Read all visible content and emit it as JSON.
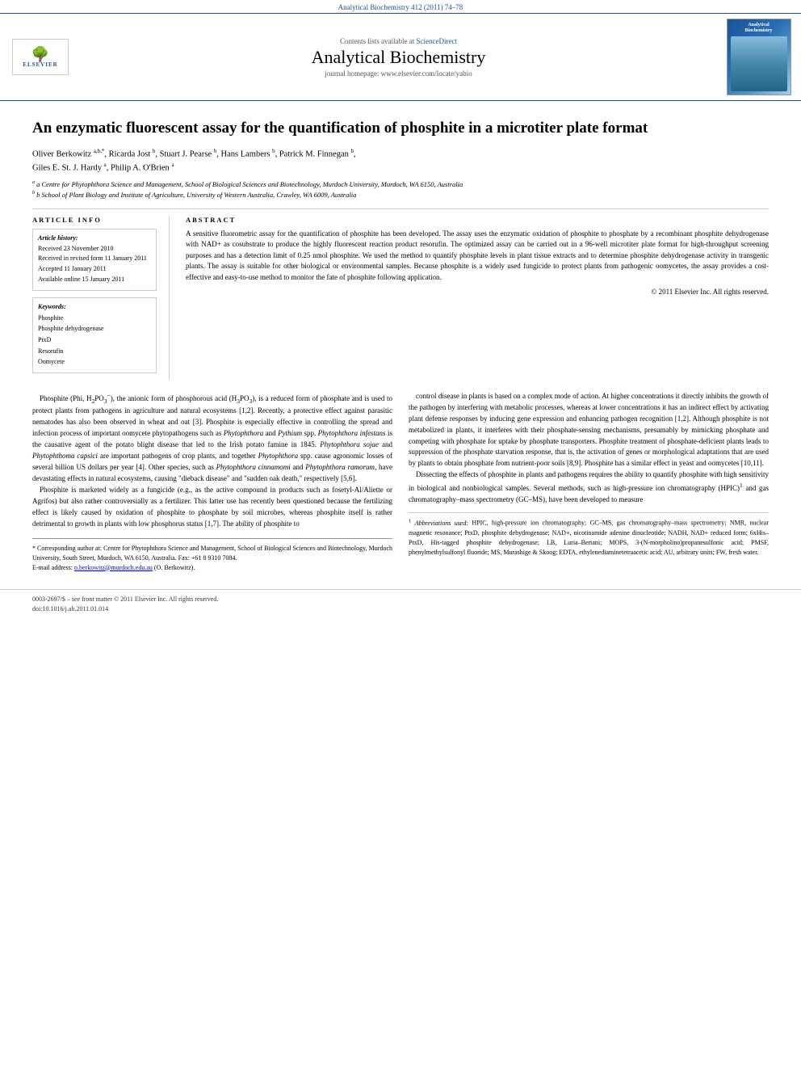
{
  "topbar": {
    "journal_ref": "Analytical Biochemistry 412 (2011) 74–78"
  },
  "header": {
    "sciencedirect_text": "Contents lists available at",
    "sciencedirect_link": "ScienceDirect",
    "journal_title": "Analytical Biochemistry",
    "homepage_text": "journal homepage: www.elsevier.com/locate/yabio",
    "elsevier_label": "ELSEVIER",
    "cover_title": "Analytical Biochemistry"
  },
  "article": {
    "title": "An enzymatic fluorescent assay for the quantification of phosphite in a microtiter plate format",
    "authors": "Oliver Berkowitz a,b,*, Ricarda Jost b, Stuart J. Pearse b, Hans Lambers b, Patrick M. Finnegan b, Giles E. St. J. Hardy a, Philip A. O'Brien a",
    "affiliation_a": "a Centre for Phytophthora Science and Management, School of Biological Sciences and Biotechnology, Murdoch University, Murdoch, WA 6150, Australia",
    "affiliation_b": "b School of Plant Biology and Institute of Agriculture, University of Western Australia, Crawley, WA 6009, Australia"
  },
  "article_info": {
    "section_label": "ARTICLE INFO",
    "history_label": "Article history:",
    "received": "Received 23 November 2010",
    "revised": "Received in revised form 11 January 2011",
    "accepted": "Accepted 11 January 2011",
    "available": "Available online 15 January 2011",
    "keywords_label": "Keywords:",
    "keywords": [
      "Phosphite",
      "Phosphite dehydrogenase",
      "PtxD",
      "Resorufin",
      "Oomycete"
    ]
  },
  "abstract": {
    "section_label": "ABSTRACT",
    "text": "A sensitive fluorometric assay for the quantification of phosphite has been developed. The assay uses the enzymatic oxidation of phosphite to phosphate by a recombinant phosphite dehydrogenase with NAD+ as cosubstrate to produce the highly fluorescent reaction product resorufin. The optimized assay can be carried out in a 96-well microtiter plate format for high-throughput screening purposes and has a detection limit of 0.25 nmol phosphite. We used the method to quantify phosphite levels in plant tissue extracts and to determine phosphite dehydrogenase activity in transgenic plants. The assay is suitable for other biological or environmental samples. Because phosphite is a widely used fungicide to protect plants from pathogenic oomycetes, the assay provides a cost-effective and easy-to-use method to monitor the fate of phosphite following application.",
    "copyright": "© 2011 Elsevier Inc. All rights reserved."
  },
  "body": {
    "left_col": "Phosphite (Phi, H2PO3−), the anionic form of phosphorous acid (H3PO3), is a reduced form of phosphate and is used to protect plants from pathogens in agriculture and natural ecosystems [1,2]. Recently, a protective effect against parasitic nematodes has also been observed in wheat and oat [3]. Phosphite is especially effective in controlling the spread and infection process of important oomycete phytopathogens such as Phytophthora and Pythium spp. Phytophthora infestans is the causative agent of the potato blight disease that led to the Irish potato famine in 1845. Phytophthora sojae and Phytophthoma capsici are important pathogens of crop plants, and together Phytophthora spp. cause agronomic losses of several billion US dollars per year [4]. Other species, such as Phytophthora cinnamomi and Phytophthora ramorum, have devastating effects in natural ecosystems, causing \"dieback disease\" and \"sudden oak death,\" respectively [5,6]. Phosphite is marketed widely as a fungicide (e.g., as the active compound in products such as fosetyl-Al/Aliette or Agrifos) but also rather controversially as a fertilizer. This latter use has recently been questioned because the fertilizing effect is likely caused by oxidation of phosphite to phosphate by soil microbes, whereas phosphite itself is rather detrimental to growth in plants with low phosphorus status [1,7]. The ability of phosphite to",
    "right_col": "control disease in plants is based on a complex mode of action. At higher concentrations it directly inhibits the growth of the pathogen by interfering with metabolic processes, whereas at lower concentrations it has an indirect effect by activating plant defense responses by inducing gene expression and enhancing pathogen recognition [1,2]. Although phosphite is not metabolized in plants, it interferes with their phosphate-sensing mechanisms, presumably by mimicking phosphate and competing with phosphate for uptake by phosphate transporters. Phosphite treatment of phosphate-deficient plants leads to suppression of the phosphate starvation response, that is, the activation of genes or morphological adaptations that are used by plants to obtain phosphate from nutrient-poor soils [8,9]. Phosphite has a similar effect in yeast and oomycetes [10,11]. Dissecting the effects of phosphite in plants and pathogens requires the ability to quantify phosphite with high sensitivity in biological and nonbiological samples. Several methods, such as high-pressure ion chromatography (HPIC)1 and gas chromatography–mass spectrometry (GC–MS), have been developed to measure"
  },
  "footnotes": {
    "corresponding": "* Corresponding author at: Centre for Phytophthora Science and Management, School of Biological Sciences and Biotechnology, Murdoch University, South Street, Murdoch, WA 6150, Australia. Fax: +61 8 9310 7084.",
    "email_label": "E-mail address:",
    "email": "o.berkowitz@murdoch.edu.au (O. Berkowitz).",
    "abbrev_title": "1 Abbreviations used:",
    "abbrev_text": "HPIC, high-pressure ion chromatography; GC–MS, gas chromatography–mass spectrometry; NMR, nuclear magnetic resonance; PtxD, phosphite dehydrogenase; NAD+, nicotinamide adenine dinucleotide; NADH, NAD+ reduced form; 6xHis–PtxD, His-tagged phosphite dehydrogenase; LB, Luria–Bertani; MOPS, 3-(N-morpholino)propanesulfonic acid; PMSF, phenylmethylsulfonyl fluoride; MS, Murashige & Skoog; EDTA, ethylenediaminetetraacetic acid; AU, arbitrary units; FW, fresh water."
  },
  "bottom": {
    "issn": "0003-2697/$ – see front matter © 2011 Elsevier Inc. All rights reserved.",
    "doi": "doi:10.1016/j.ab.2011.01.014"
  }
}
